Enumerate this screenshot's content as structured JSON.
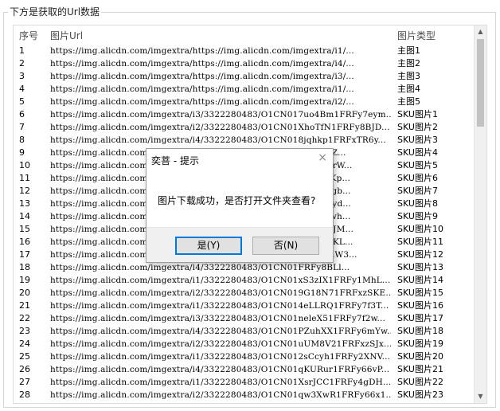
{
  "groupbox": {
    "title": "下方是获取的Url数据"
  },
  "table": {
    "headers": {
      "index": "序号",
      "url": "图片Url",
      "type": "图片类型"
    },
    "rows": [
      {
        "idx": "1",
        "url": "https://img.alicdn.com/imgextra/https://img.alicdn.com/imgextra/i1/...",
        "type": "主图1"
      },
      {
        "idx": "2",
        "url": "https://img.alicdn.com/imgextra/https://img.alicdn.com/imgextra/i4/...",
        "type": "主图2"
      },
      {
        "idx": "3",
        "url": "https://img.alicdn.com/imgextra/https://img.alicdn.com/imgextra/i3/...",
        "type": "主图3"
      },
      {
        "idx": "4",
        "url": "https://img.alicdn.com/imgextra/https://img.alicdn.com/imgextra/i1/...",
        "type": "主图4"
      },
      {
        "idx": "5",
        "url": "https://img.alicdn.com/imgextra/https://img.alicdn.com/imgextra/i2/...",
        "type": "主图5"
      },
      {
        "idx": "6",
        "url": "https://img.alicdn.com/imgextra/i3/3322280483/O1CN017uo4Bm1FRFy7eym...",
        "type": "SKU图片1"
      },
      {
        "idx": "7",
        "url": "https://img.alicdn.com/imgextra/i2/3322280483/O1CN01XhoTfN1FRFy8BJD...",
        "type": "SKU图片2"
      },
      {
        "idx": "8",
        "url": "https://img.alicdn.com/imgextra/i4/3322280483/O1CN018jqhkp1FRFxTR6y...",
        "type": "SKU图片3"
      },
      {
        "idx": "9",
        "url": "https://img.alicdn.com/imgextra/i4/3322280483/O1CN01FRFy5aZ...",
        "type": "SKU图片4"
      },
      {
        "idx": "10",
        "url": "https://img.alicdn.com/imgextra/i4/3322280483/O1CN01FRFxyRrW...",
        "type": "SKU图片5"
      },
      {
        "idx": "11",
        "url": "https://img.alicdn.com/imgextra/i4/3322280483/O1CN01FRFy4JKp...",
        "type": "SKU图片6"
      },
      {
        "idx": "12",
        "url": "https://img.alicdn.com/imgextra/i4/3322280483/O1CN01FRFxy5gb...",
        "type": "SKU图片7"
      },
      {
        "idx": "13",
        "url": "https://img.alicdn.com/imgextra/i4/3322280483/O1CN01FRFxyRyd...",
        "type": "SKU图片8"
      },
      {
        "idx": "14",
        "url": "https://img.alicdn.com/imgextra/i4/3322280483/O1CN01FRFy1lwh...",
        "type": "SKU图片9"
      },
      {
        "idx": "15",
        "url": "https://img.alicdn.com/imgextra/i4/3322280483/O1CN01FRFy1KJM...",
        "type": "SKU图片10"
      },
      {
        "idx": "16",
        "url": "https://img.alicdn.com/imgextra/i4/3322280483/O1CN01FRFy2XKL...",
        "type": "SKU图片11"
      },
      {
        "idx": "17",
        "url": "https://img.alicdn.com/imgextra/i4/3322280483/O1CN01FRFy6mW3...",
        "type": "SKU图片12"
      },
      {
        "idx": "18",
        "url": "https://img.alicdn.com/imgextra/i4/3322280483/O1CN01FRFy8BLl...",
        "type": "SKU图片13"
      },
      {
        "idx": "19",
        "url": "https://img.alicdn.com/imgextra/i1/3322280483/O1CN01xS3zIX1FRFy1MhL...",
        "type": "SKU图片14"
      },
      {
        "idx": "20",
        "url": "https://img.alicdn.com/imgextra/i2/3322280483/O1CN019G18N71FRFxzSKE...",
        "type": "SKU图片15"
      },
      {
        "idx": "21",
        "url": "https://img.alicdn.com/imgextra/i1/3322280483/O1CN014eLLRQ1FRFy7f3T...",
        "type": "SKU图片16"
      },
      {
        "idx": "22",
        "url": "https://img.alicdn.com/imgextra/i3/3322280483/O1CN01neleX51FRFy7f2w...",
        "type": "SKU图片17"
      },
      {
        "idx": "23",
        "url": "https://img.alicdn.com/imgextra/i4/3322280483/O1CN01PZuhXX1FRFy6mYw...",
        "type": "SKU图片18"
      },
      {
        "idx": "24",
        "url": "https://img.alicdn.com/imgextra/i2/3322280483/O1CN01uUM8V21FRFxzSJx...",
        "type": "SKU图片19"
      },
      {
        "idx": "25",
        "url": "https://img.alicdn.com/imgextra/i1/3322280483/O1CN012sCcyh1FRFy2XNV...",
        "type": "SKU图片20"
      },
      {
        "idx": "26",
        "url": "https://img.alicdn.com/imgextra/i4/3322280483/O1CN01qKURur1FRFy66vP...",
        "type": "SKU图片21"
      },
      {
        "idx": "27",
        "url": "https://img.alicdn.com/imgextra/i1/3322280483/O1CN01XsrJCC1FRFy4gDH...",
        "type": "SKU图片22"
      },
      {
        "idx": "28",
        "url": "https://img.alicdn.com/imgextra/i2/3322280483/O1CN01qw3XwR1FRFy66x1...",
        "type": "SKU图片23"
      }
    ]
  },
  "dialog": {
    "title": "奕菩 - 提示",
    "message": "图片下载成功，是否打开文件夹查看?",
    "yes_label": "是(Y)",
    "no_label": "否(N)",
    "close_glyph": "×"
  },
  "scrollbar": {
    "up_glyph": "▲",
    "down_glyph": "▼"
  },
  "colors": {
    "accent": "#0078d7",
    "footer_bg": "#f0f0f0",
    "button_bg": "#e1e1e1"
  }
}
